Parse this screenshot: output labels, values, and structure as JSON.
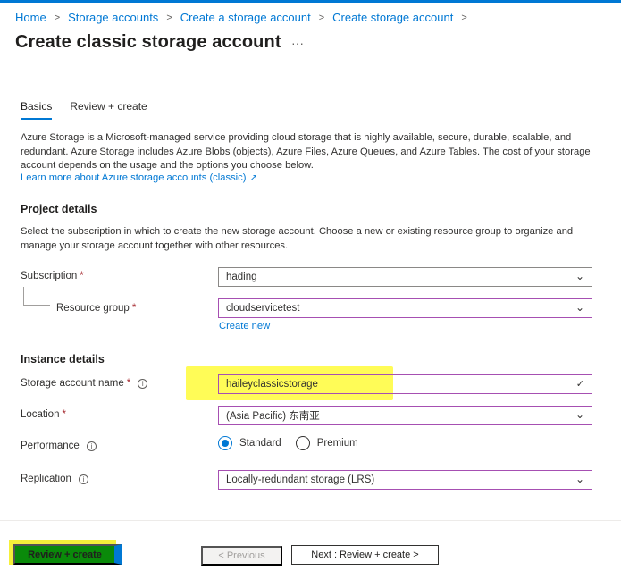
{
  "breadcrumb": {
    "items": [
      "Home",
      "Storage accounts",
      "Create a storage account",
      "Create storage account"
    ],
    "separator": ">"
  },
  "page": {
    "title": "Create classic storage account",
    "more": "···"
  },
  "tabs": [
    {
      "label": "Basics",
      "active": true
    },
    {
      "label": "Review + create",
      "active": false
    }
  ],
  "intro": {
    "text": "Azure Storage is a Microsoft-managed service providing cloud storage that is highly available, secure, durable, scalable, and redundant. Azure Storage includes Azure Blobs (objects), Azure Files, Azure Queues, and Azure Tables. The cost of your storage account depends on the usage and the options you choose below.",
    "link": "Learn more about Azure storage accounts (classic)"
  },
  "project": {
    "title": "Project details",
    "desc": "Select the subscription in which to create the new storage account. Choose a new or existing resource group to organize and manage your storage account together with other resources.",
    "subscription_label": "Subscription",
    "subscription_value": "hading",
    "rg_label": "Resource group",
    "rg_value": "cloudservicetest",
    "create_new": "Create new"
  },
  "instance": {
    "title": "Instance details",
    "name_label": "Storage account name",
    "name_value": "haileyclassicstorage",
    "location_label": "Location",
    "location_value": "(Asia Pacific) 东南亚",
    "performance_label": "Performance",
    "performance_options": [
      "Standard",
      "Premium"
    ],
    "performance_selected": "Standard",
    "replication_label": "Replication",
    "replication_value": "Locally-redundant storage (LRS)"
  },
  "footer": {
    "review_create": "Review + create",
    "previous": "< Previous",
    "next": "Next : Review + create >"
  },
  "required_mark": "*",
  "info_glyph": "i",
  "icons": {
    "chevron": "chevron-down-icon",
    "check": "check-icon",
    "external": "external-link-icon",
    "info": "info-icon"
  },
  "colors": {
    "accent": "#0078d4",
    "required": "#a4262c",
    "highlight": "#fffb3a",
    "review_button": "#0a8a0a",
    "input_border_active": "#a64fb2"
  }
}
